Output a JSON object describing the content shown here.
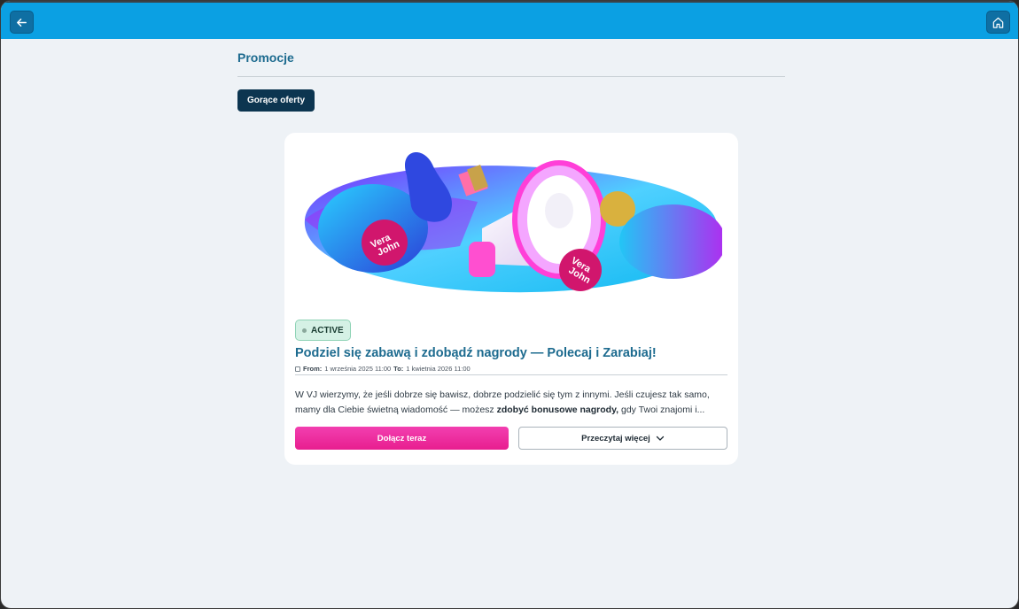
{
  "header": {
    "back_icon": "arrow-left-icon",
    "home_icon": "home-icon",
    "bar_color": "#0ba0e3"
  },
  "page": {
    "title": "Promocje",
    "filter_button": "Gorące oferty"
  },
  "promo": {
    "banner_image": "megaphone-vera-john-banner",
    "status": "ACTIVE",
    "title": "Podziel się zabawą i zdobądź nagrody — Polecaj i Zarabiaj!",
    "from_label": "From:",
    "from_value": "1 września 2025 11:00",
    "to_label": "To:",
    "to_value": "1 kwietnia 2026 11:00",
    "description_part1": "W VJ wierzymy, że jeśli dobrze się bawisz, dobrze podzielić się tym z innymi. Jeśli czujesz tak samo, mamy dla Ciebie świetną wiadomość — możesz ",
    "description_bold": "zdobyć bonusowe nagrody,",
    "description_part2": " gdy Twoi znajomi i...",
    "join_button": "Dołącz teraz",
    "read_more_button": "Przeczytaj więcej",
    "accent_color": "#e81e8f"
  }
}
